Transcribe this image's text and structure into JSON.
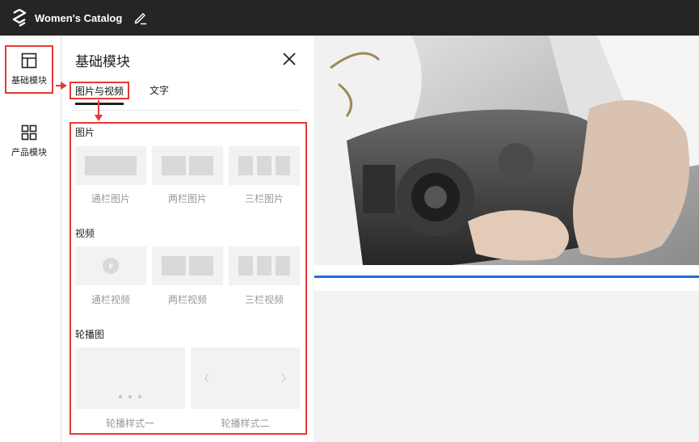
{
  "app": {
    "title": "Women's Catalog"
  },
  "rail": {
    "items": [
      {
        "label": "基础模块",
        "icon": "layout-icon",
        "active": true
      },
      {
        "label": "产品模块",
        "icon": "grid-icon",
        "active": false
      }
    ]
  },
  "panel": {
    "title": "基础模块",
    "tabs": [
      {
        "label": "图片与视频",
        "active": true
      },
      {
        "label": "文字",
        "active": false
      }
    ],
    "sections": {
      "image": {
        "label": "图片",
        "tiles": [
          "通栏图片",
          "两栏图片",
          "三栏图片"
        ]
      },
      "video": {
        "label": "视频",
        "tiles": [
          "通栏视频",
          "两栏视频",
          "三栏视频"
        ]
      },
      "carousel": {
        "label": "轮播图",
        "tiles": [
          "轮播样式一",
          "轮播样式二"
        ]
      }
    }
  },
  "colors": {
    "accent": "#e53935",
    "topbar": "#252525",
    "selection": "#1f6fd6"
  }
}
